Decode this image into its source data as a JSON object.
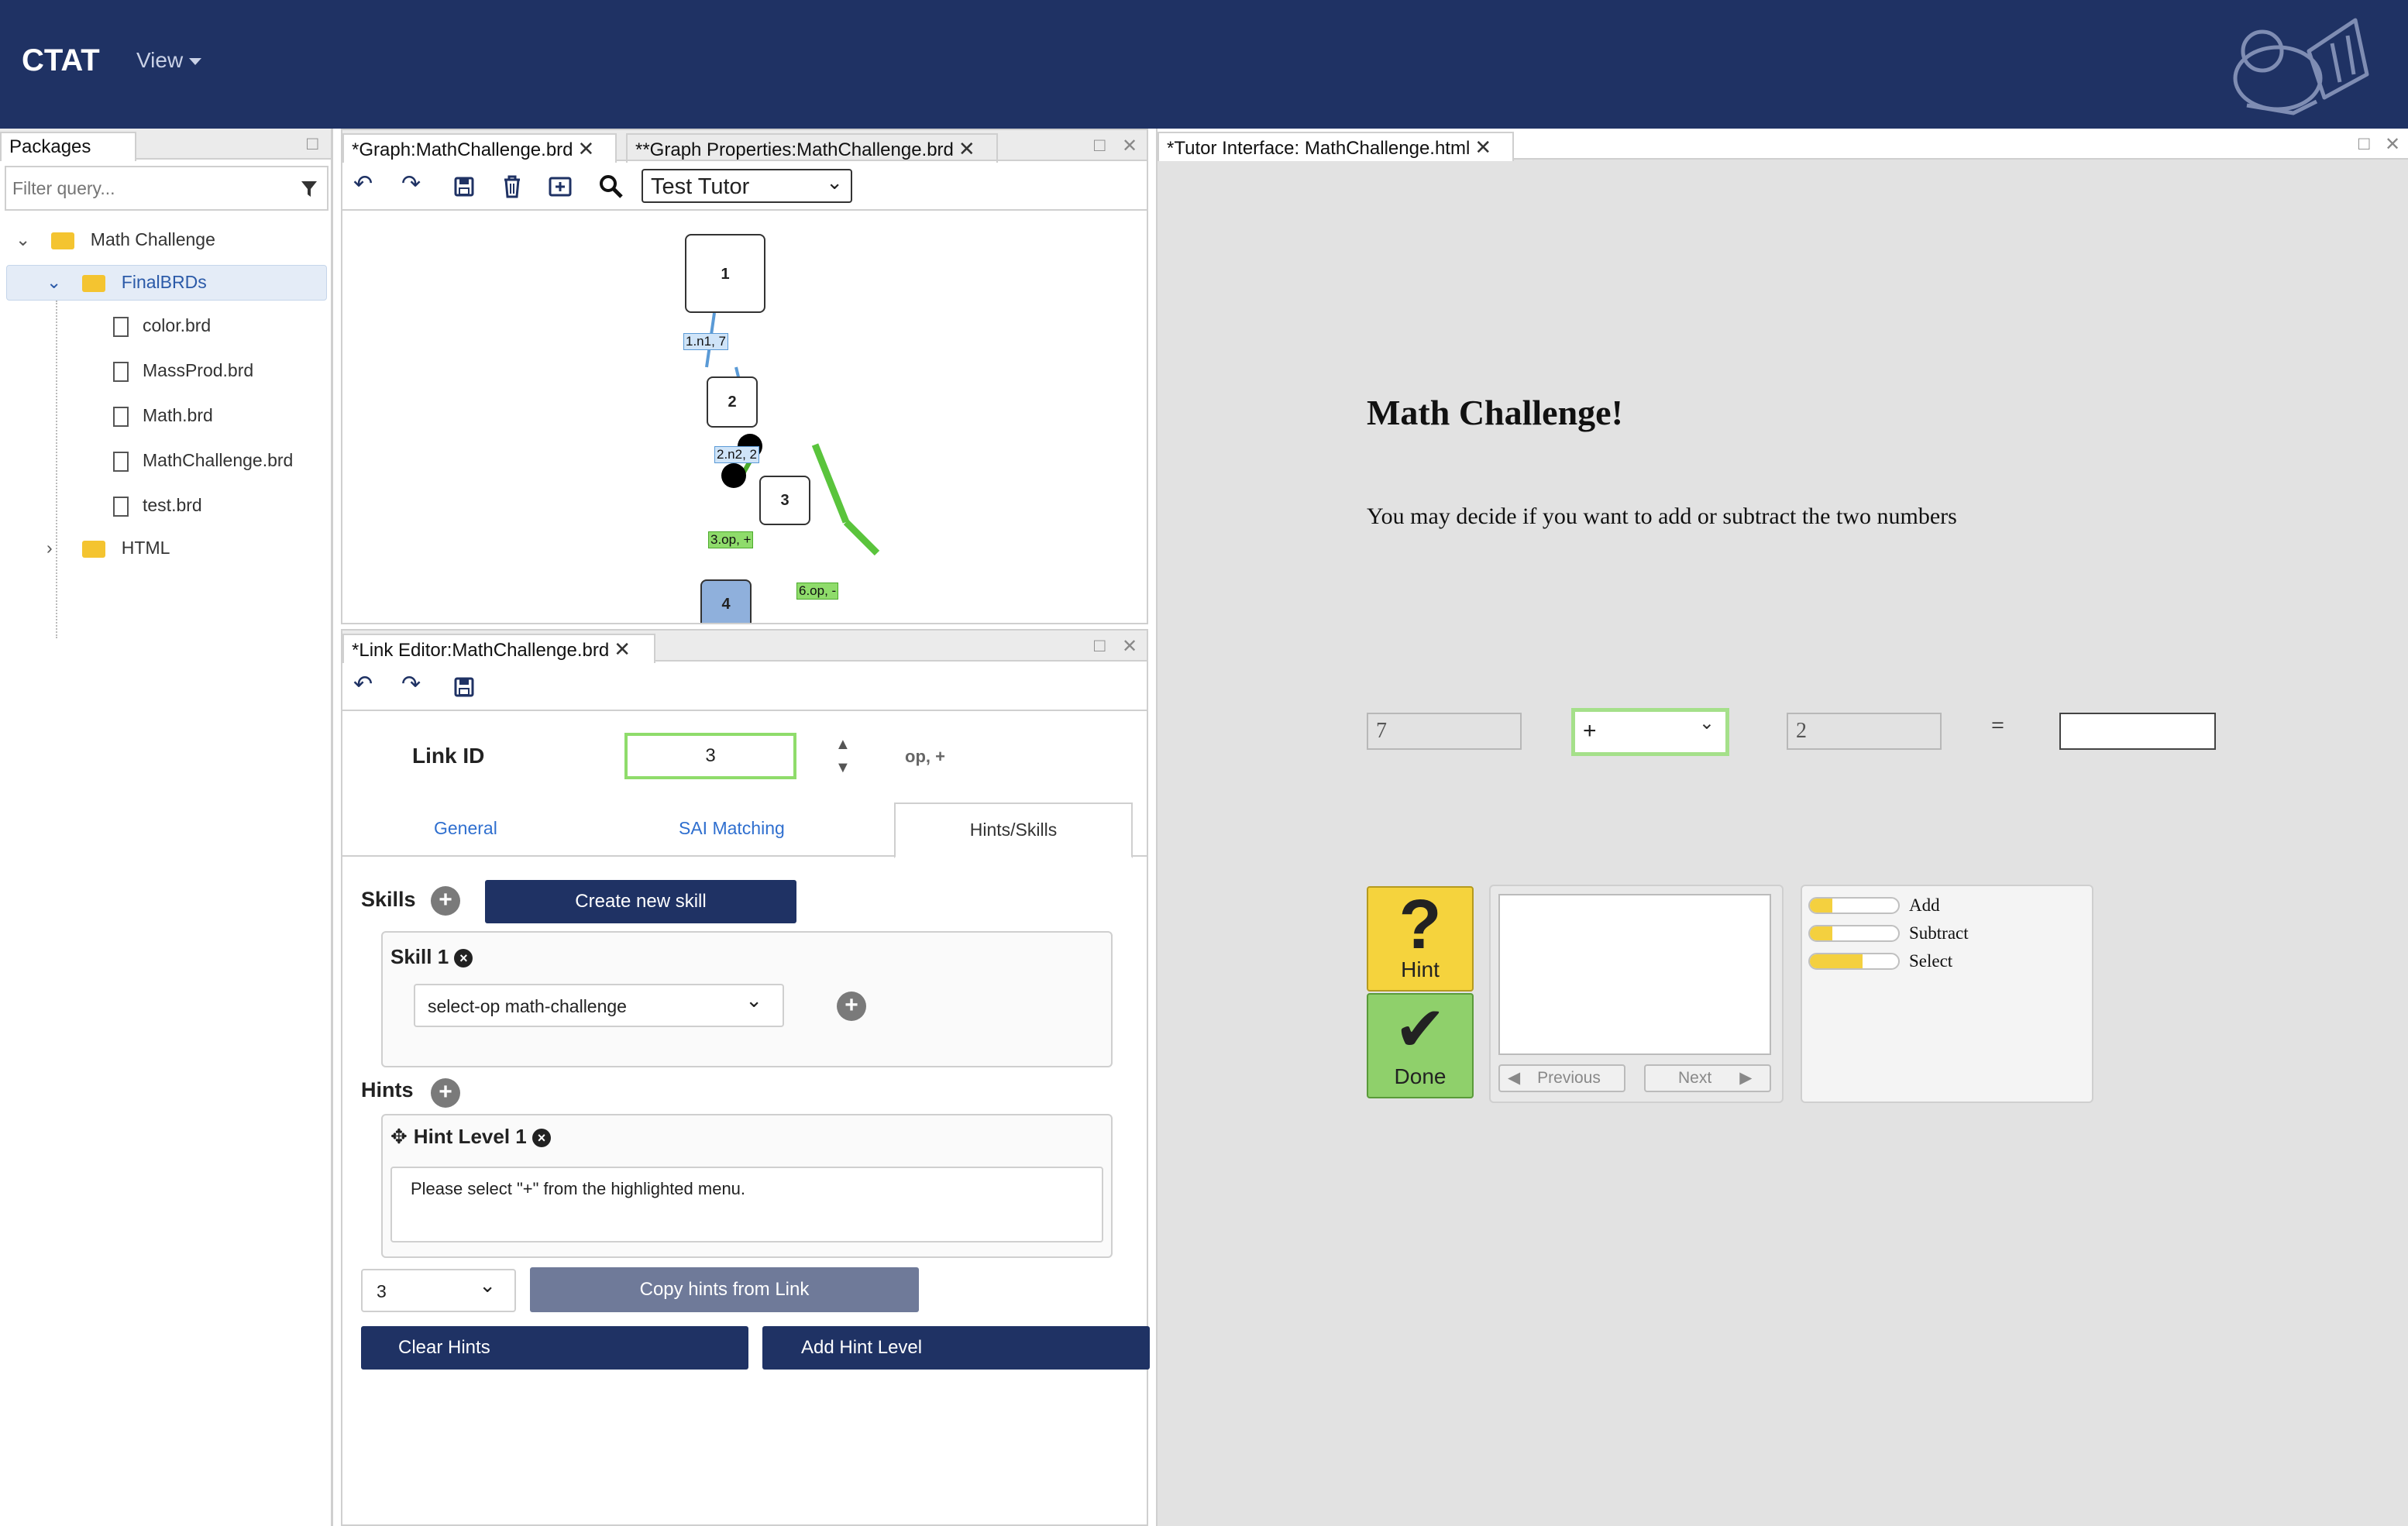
{
  "app": {
    "name": "CTAT",
    "view_menu": "View"
  },
  "packages": {
    "tab_label": "Packages",
    "filter_placeholder": "Filter query...",
    "tree": [
      {
        "label": "Math Challenge",
        "type": "folder",
        "expanded": true
      },
      {
        "label": "FinalBRDs",
        "type": "folder",
        "expanded": true,
        "selected": true
      },
      {
        "label": "color.brd",
        "type": "file"
      },
      {
        "label": "MassProd.brd",
        "type": "file"
      },
      {
        "label": "Math.brd",
        "type": "file"
      },
      {
        "label": "MathChallenge.brd",
        "type": "file"
      },
      {
        "label": "test.brd",
        "type": "file"
      },
      {
        "label": "HTML",
        "type": "folder",
        "expanded": false
      }
    ]
  },
  "graph_panel": {
    "tabs": [
      "*Graph:MathChallenge.brd",
      "**Graph Properties:MathChallenge.brd"
    ],
    "mode_select": "Test Tutor",
    "nodes": [
      "1",
      "2",
      "3",
      "4"
    ],
    "edge_labels": [
      "1.n1, 7",
      "2.n2, 2",
      "3.op, +",
      "6.op, -"
    ]
  },
  "link_editor": {
    "tab": "*Link Editor:MathChallenge.brd",
    "link_id_label": "Link ID",
    "link_id_value": "3",
    "link_summary": "op, +",
    "tabs": [
      "General",
      "SAI Matching",
      "Hints/Skills"
    ],
    "skills_label": "Skills",
    "create_skill": "Create new skill",
    "skill_title": "Skill 1",
    "skill_select": "select-op math-challenge",
    "hints_label": "Hints",
    "hint_title": "Hint Level 1",
    "hint_text": "Please select \"+\" from the highlighted menu.",
    "copy_select": "3",
    "copy_button": "Copy hints from Link",
    "clear_button": "Clear Hints",
    "add_button": "Add Hint Level"
  },
  "tutor": {
    "tab": "*Tutor Interface: MathChallenge.html",
    "title": "Math Challenge!",
    "instructions": "You may decide if you want to add or subtract the two numbers",
    "n1": "7",
    "op": "+",
    "n2": "2",
    "equals": "=",
    "answer": "",
    "hint_label": "Hint",
    "done_label": "Done",
    "previous": "Previous",
    "next": "Next",
    "skills": [
      {
        "name": "Add",
        "mastery": 0.25
      },
      {
        "name": "Subtract",
        "mastery": 0.25
      },
      {
        "name": "Select",
        "mastery": 0.6
      }
    ]
  }
}
